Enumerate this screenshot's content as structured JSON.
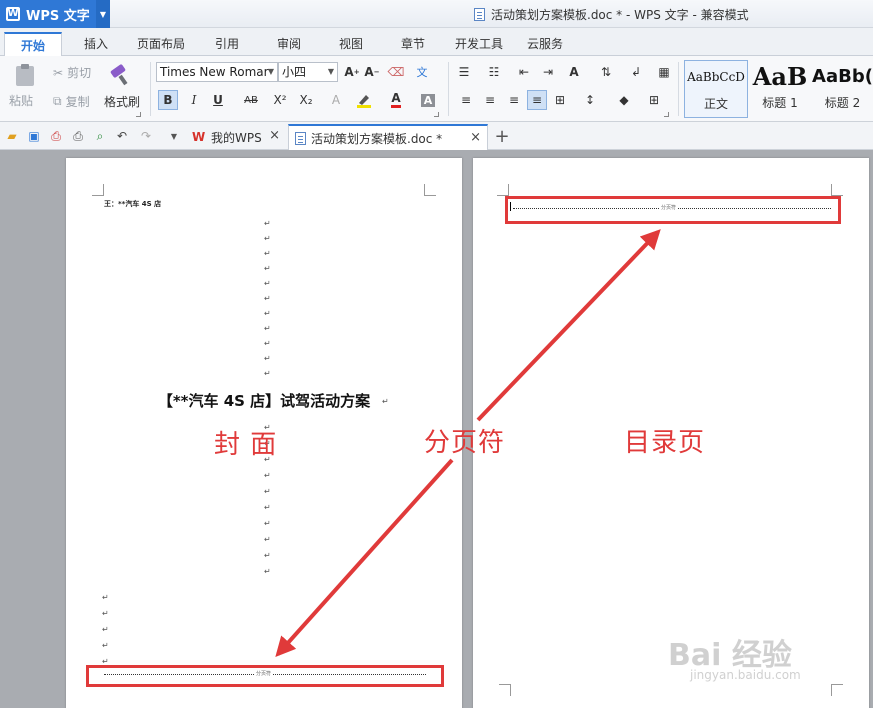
{
  "titlebar": {
    "app_name": "WPS 文字",
    "document_title": "活动策划方案模板.doc * - WPS 文字 - 兼容模式"
  },
  "menu_tabs": [
    {
      "label": "开始",
      "active": true
    },
    {
      "label": "插入",
      "active": false
    },
    {
      "label": "页面布局",
      "active": false
    },
    {
      "label": "引用",
      "active": false
    },
    {
      "label": "审阅",
      "active": false
    },
    {
      "label": "视图",
      "active": false
    },
    {
      "label": "章节",
      "active": false
    },
    {
      "label": "开发工具",
      "active": false
    },
    {
      "label": "云服务",
      "active": false
    }
  ],
  "ribbon": {
    "paste_label": "粘贴",
    "cut_label": "剪切",
    "copy_label": "复制",
    "format_painter_label": "格式刷",
    "font_name": "Times New Romar",
    "font_size": "小四",
    "bold_label": "B",
    "italic_label": "I",
    "underline_label": "U",
    "strike_label": "AB",
    "superscript_label": "X²",
    "subscript_label": "X₂",
    "wen_label": "文",
    "styles": [
      {
        "sample": "AaBbCcD",
        "name": "正文"
      },
      {
        "sample": "AaB",
        "name": "标题 1"
      },
      {
        "sample": "AaBb(",
        "name": "标题 2"
      }
    ]
  },
  "doc_tabs": [
    {
      "label": "我的WPS",
      "active": false
    },
    {
      "label": "活动策划方案模板.doc *",
      "active": true
    }
  ],
  "page1": {
    "header_text": "王：**汽车 4S 店",
    "title": "【**汽车 4S 店】试驾活动方案",
    "paragraph_mark": "↵",
    "page_break_label": "分页符"
  },
  "page2": {
    "page_break_label": "分页符"
  },
  "annotations": {
    "cover": "封 面",
    "page_break": "分页符",
    "toc_page": "目录页"
  },
  "watermark": {
    "brand": "Bai 经验",
    "url": "jingyan.baidu.com"
  },
  "colors": {
    "accent": "#2f78d6",
    "annotation_red": "#e03a3a"
  }
}
